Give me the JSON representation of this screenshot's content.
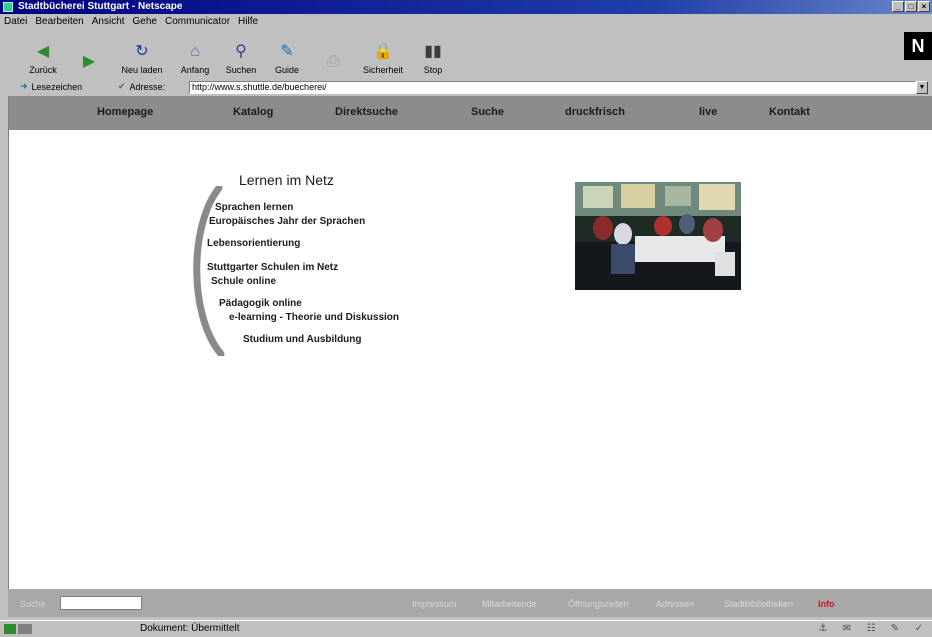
{
  "window": {
    "title": "Stadtbücherei Stuttgart - Netscape"
  },
  "menubar": [
    "Datei",
    "Bearbeiten",
    "Ansicht",
    "Gehe",
    "Communicator",
    "Hilfe"
  ],
  "toolbar": {
    "buttons": [
      {
        "label": "Zurück",
        "icon": "back-arrow-icon"
      },
      {
        "label": "",
        "icon": "forward-arrow-icon"
      },
      {
        "label": "Neu laden",
        "icon": "reload-icon"
      },
      {
        "label": "Anfang",
        "icon": "home-icon"
      },
      {
        "label": "Suchen",
        "icon": "search-icon"
      },
      {
        "label": "Guide",
        "icon": "guide-icon"
      },
      {
        "label": "",
        "icon": "print-icon"
      },
      {
        "label": "Sicherheit",
        "icon": "security-icon"
      },
      {
        "label": "Stop",
        "icon": "stop-icon"
      }
    ],
    "logo": "N"
  },
  "location": {
    "bookmarks_label": "Lesezeichen",
    "address_label": "Adresse:",
    "address_value": "http://www.s.shuttle.de/buecherei/"
  },
  "nav": [
    "Homepage",
    "Katalog",
    "Direktsuche",
    "Suche",
    "druckfrisch",
    "live",
    "Kontakt"
  ],
  "menu": {
    "title": "Lernen im Netz",
    "entries": [
      "Sprachen lernen",
      "Europäisches Jahr der Sprachen",
      "Lebensorientierung",
      "Stuttgarter Schulen im Netz",
      "Schule online",
      "Pädagogik online",
      "e-learning - Theorie und Diskussion",
      "Studium und Ausbildung"
    ]
  },
  "footer": {
    "search_label": "Suche",
    "links": [
      "Impressum",
      "Mitarbeitende",
      "Öffnungszeiten",
      "Adressen",
      "Stadtbibliotheken"
    ],
    "badge": "Info"
  },
  "status": {
    "text": "Dokument: Übermittelt"
  },
  "colors": {
    "nav_bar": "#8c8c8c",
    "title_bar": "#000080",
    "footer_bar": "#a8a8a8",
    "badge_red": "#e0101a"
  }
}
